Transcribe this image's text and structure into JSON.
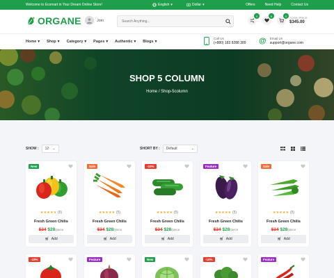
{
  "topbar": {
    "welcome": "Welcome to Ecomart in Your Dream Online Store!",
    "language": "English",
    "currency": "Dollar",
    "links": [
      "Offers",
      "Need Help",
      "Contact Us"
    ]
  },
  "header": {
    "logo": "ORGANE",
    "join": "Join",
    "search_placeholder": "Search Anything...",
    "badges": {
      "compare": "0",
      "wishlist": "0",
      "cart": "0"
    },
    "total_label": "TOTAL PRICE",
    "total_amount": "$345.00"
  },
  "nav": {
    "items": [
      "Home",
      "Shop",
      "Category",
      "Pages",
      "Authentic",
      "Blogs"
    ],
    "call_label": "Call Us",
    "call_value": "(+880) 183 8288 389",
    "email_label": "Email Us",
    "email_value": "support@organe.com"
  },
  "banner": {
    "title": "SHOP 5 COLUMN",
    "crumb_home": "Home",
    "crumb_sep": "/",
    "crumb_current": "Shop-5column"
  },
  "toolbar": {
    "show_label": "SHOW :",
    "show_value": "12",
    "sort_label": "SHORT BY :",
    "sort_value": "Default"
  },
  "products": [
    {
      "tag": "New",
      "tag_color": "#1f9e4b",
      "name": "Fresh Green Chilis",
      "stars": "★★★★★",
      "count": "(5)",
      "old": "$34",
      "new": "$28",
      "unit": "/piece",
      "add": "Add",
      "image": "bell-peppers"
    },
    {
      "tag": "Sale",
      "tag_color": "#f26b3a",
      "name": "Fresh Green Chilis",
      "stars": "★★★★★",
      "count": "(5)",
      "old": "$34",
      "new": "$28",
      "unit": "/piece",
      "add": "Add",
      "image": "carrots"
    },
    {
      "tag": "-10%",
      "tag_color": "#e63b2e",
      "name": "Fresh Green Chilis",
      "stars": "★★★★★",
      "count": "(5)",
      "old": "$34",
      "new": "$28",
      "unit": "/piece",
      "add": "Add",
      "image": "cucumbers"
    },
    {
      "tag": "Feature",
      "tag_color": "#9b2fbf",
      "name": "Fresh Green Chilis",
      "stars": "★★★★★",
      "count": "(5)",
      "old": "$34",
      "new": "$28",
      "unit": "/piece",
      "add": "Add",
      "image": "eggplants"
    },
    {
      "tag": "Sale",
      "tag_color": "#f26b3a",
      "name": "Fresh Green Chilis",
      "stars": "★★★★★",
      "count": "(5)",
      "old": "$34",
      "new": "$28",
      "unit": "/piece",
      "add": "Add",
      "image": "okra"
    }
  ],
  "products_row2": [
    {
      "tag": "-10%",
      "tag_color": "#e63b2e",
      "image": "tomato"
    },
    {
      "tag": "Feature",
      "tag_color": "#9b2fbf",
      "image": "onion"
    },
    {
      "tag": "New",
      "tag_color": "#1f9e4b",
      "image": "cabbage"
    },
    {
      "tag": "-10%",
      "tag_color": "#e63b2e",
      "image": "broccoli"
    },
    {
      "tag": "Feature",
      "tag_color": "#9b2fbf",
      "image": "red-chili"
    }
  ]
}
